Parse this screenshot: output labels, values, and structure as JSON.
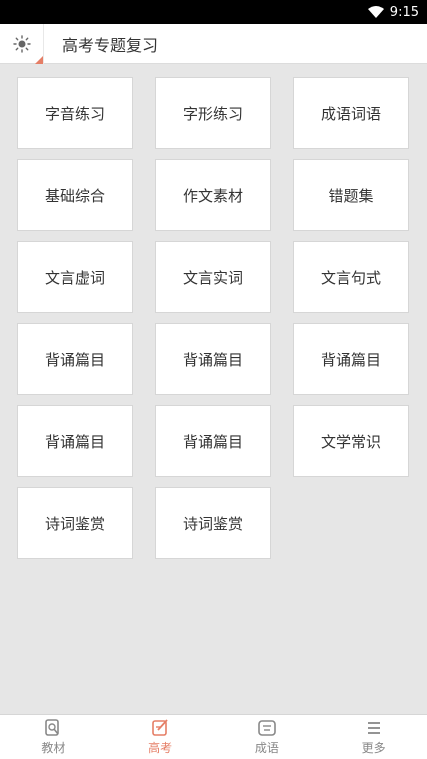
{
  "status_bar": {
    "time": "9:15",
    "wifi_icon": "wifi-icon"
  },
  "header": {
    "theme_icon": "sun-icon",
    "title": "高考专题复习"
  },
  "tiles": [
    "字音练习",
    "字形练习",
    "成语词语",
    "基础综合",
    "作文素材",
    "错题集",
    "文言虚词",
    "文言实词",
    "文言句式",
    "背诵篇目",
    "背诵篇目",
    "背诵篇目",
    "背诵篇目",
    "背诵篇目",
    "文学常识",
    "诗词鉴赏",
    "诗词鉴赏"
  ],
  "tabs": [
    {
      "label": "教材",
      "icon": "textbook-search-icon",
      "active": false
    },
    {
      "label": "高考",
      "icon": "edit-icon",
      "active": true
    },
    {
      "label": "成语",
      "icon": "idiom-icon",
      "active": false
    },
    {
      "label": "更多",
      "icon": "menu-icon",
      "active": false
    }
  ],
  "colors": {
    "accent": "#e57e66",
    "background": "#e6e6e6"
  }
}
